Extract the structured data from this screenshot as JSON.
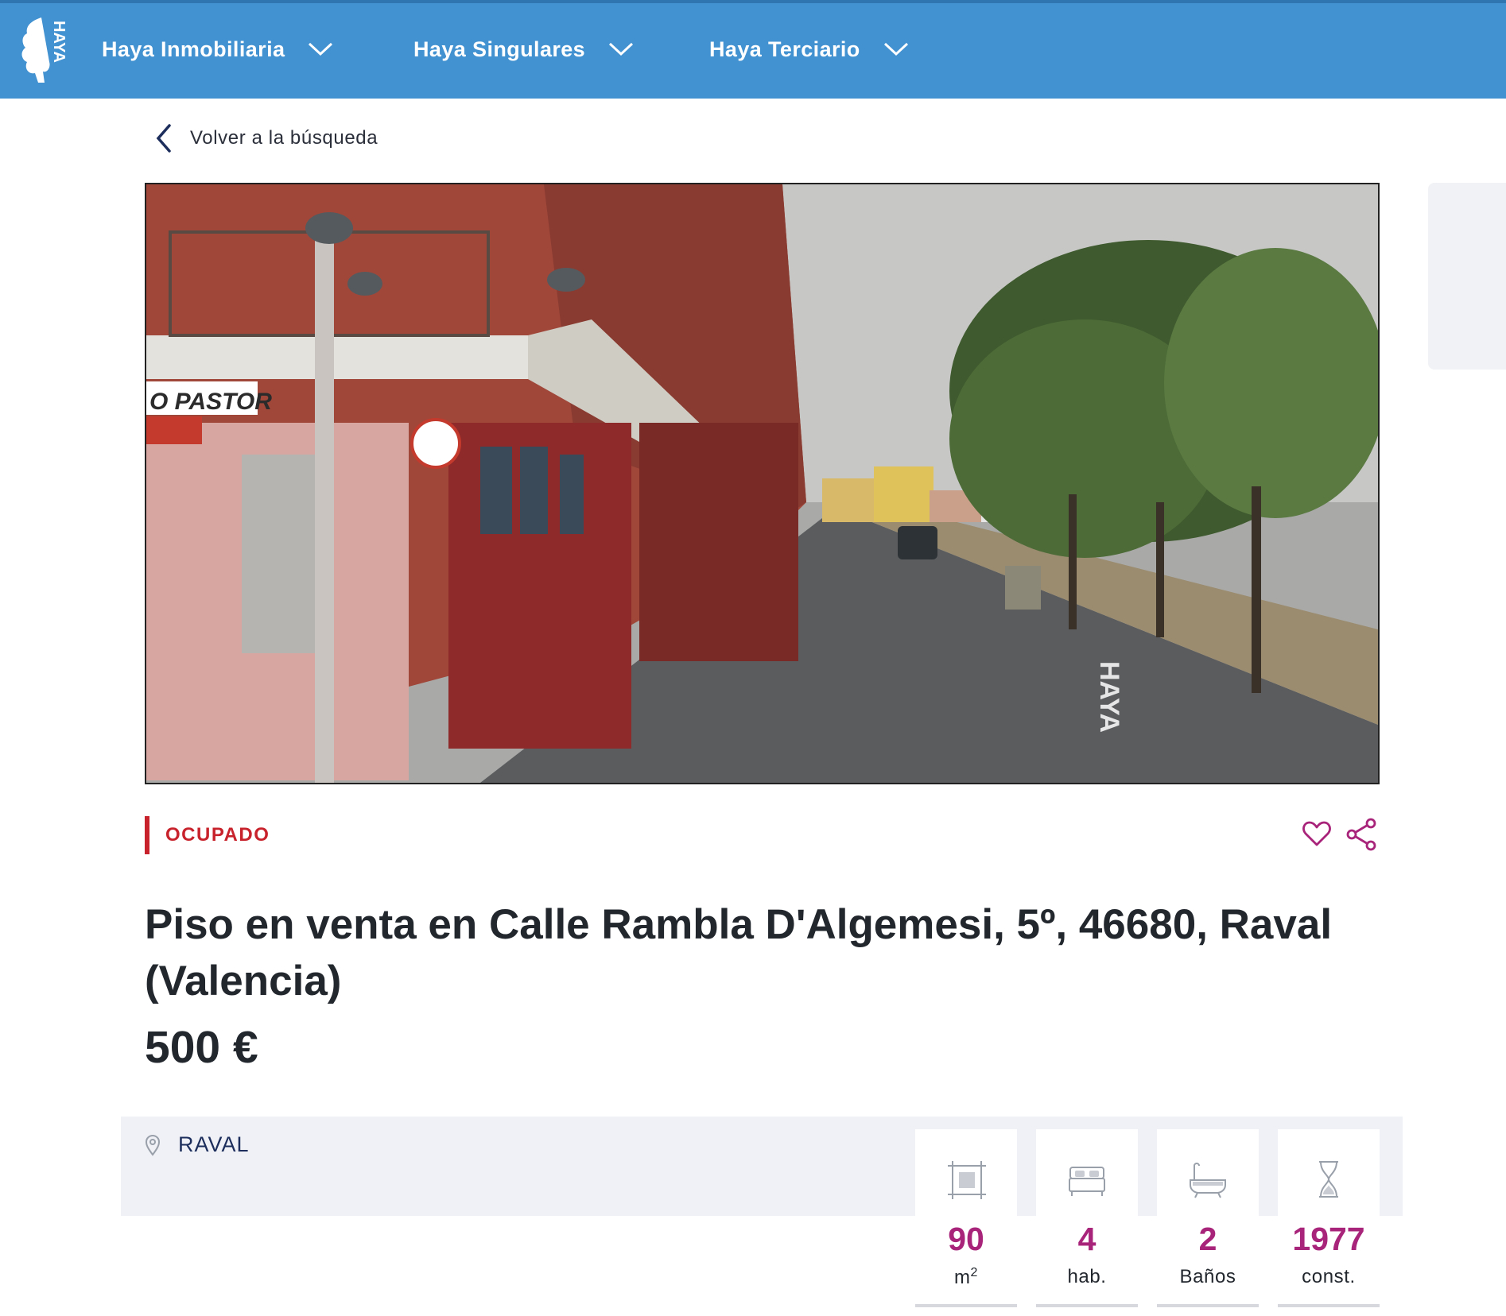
{
  "nav": {
    "items": [
      {
        "label": "Haya Inmobiliaria"
      },
      {
        "label": "Haya Singulares"
      },
      {
        "label": "Haya Terciario"
      }
    ],
    "logo_text": "HAYA",
    "bg_color": "#4291d0"
  },
  "back_link": {
    "label": "Volver a la búsqueda",
    "icon": "chevron-left-icon"
  },
  "photo": {
    "sign_text": "O PASTOR",
    "watermark": "HAYA"
  },
  "status": {
    "label": "OCUPADO",
    "color": "#c8232c"
  },
  "actions": {
    "favorite_icon": "heart-icon",
    "share_icon": "share-icon"
  },
  "listing": {
    "title": "Piso en venta en Calle Rambla D'Algemesi, 5º, 46680, Raval (Valencia)",
    "price": "500 €"
  },
  "location": {
    "label": "RAVAL",
    "icon": "location-pin-icon"
  },
  "features": [
    {
      "icon": "area-icon",
      "value": "90",
      "unit": "m",
      "unit_sup": "2"
    },
    {
      "icon": "bed-icon",
      "value": "4",
      "unit": "hab."
    },
    {
      "icon": "bathtub-icon",
      "value": "2",
      "unit": "Baños"
    },
    {
      "icon": "hourglass-icon",
      "value": "1977",
      "unit": "const."
    }
  ],
  "accent_color": "#a8247a"
}
